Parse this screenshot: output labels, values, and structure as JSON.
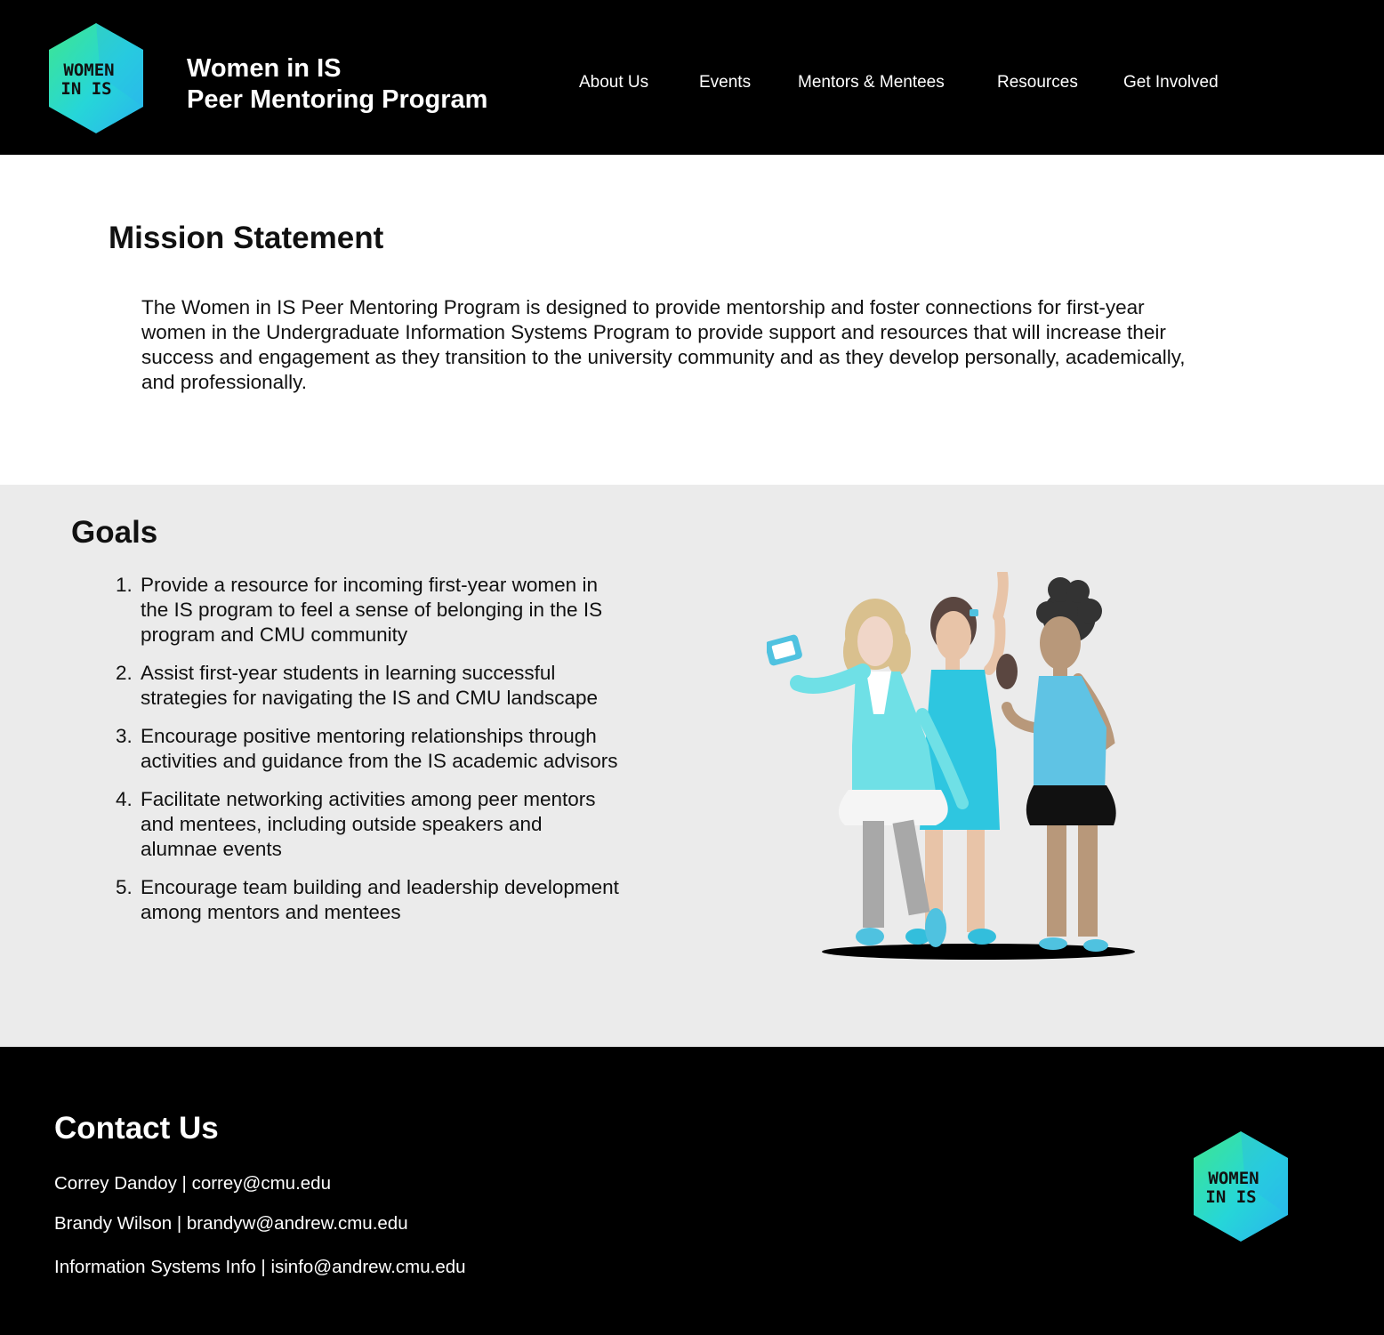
{
  "header": {
    "logo_text": [
      "WOMEN",
      "IN IS"
    ],
    "title_line1": "Women in IS",
    "title_line2": "Peer Mentoring Program",
    "nav": [
      {
        "label": "About Us"
      },
      {
        "label": "Events"
      },
      {
        "label": "Mentors & Mentees"
      },
      {
        "label": "Resources"
      },
      {
        "label": "Get Involved"
      }
    ]
  },
  "mission": {
    "heading": "Mission Statement",
    "body": "The Women in IS Peer Mentoring Program is designed to provide mentorship and foster connections for first-year women in the Undergraduate Information Systems Program to provide support and resources that will increase their success and engagement as they transition to the university community and as they develop personally, academically, and professionally."
  },
  "goals": {
    "heading": "Goals",
    "items": [
      {
        "num": "1.",
        "text": "Provide a resource for incoming first-year women in the IS program to feel a sense of belonging in the IS program and CMU community"
      },
      {
        "num": "2.",
        "text": "Assist first-year students in learning successful strategies for navigating the IS and CMU landscape"
      },
      {
        "num": "3.",
        "text": "Encourage positive mentoring relationships through activities and guidance from the IS academic advisors"
      },
      {
        "num": "4.",
        "text": "Facilitate networking activities among peer mentors and mentees, including outside speakers and alumnae events"
      },
      {
        "num": "5.",
        "text": "Encourage team building and leadership development among mentors and mentees"
      }
    ]
  },
  "footer": {
    "heading": "Contact Us",
    "contacts": [
      "Correy Dandoy | correy@cmu.edu",
      "Brandy Wilson | brandyw@andrew.cmu.edu",
      "Information Systems Info | isinfo@andrew.cmu.edu"
    ]
  },
  "colors": {
    "brand_green": "#3ee68f",
    "brand_blue": "#2ab4ee",
    "header_bg": "#000000",
    "goals_bg": "#ebebeb"
  }
}
